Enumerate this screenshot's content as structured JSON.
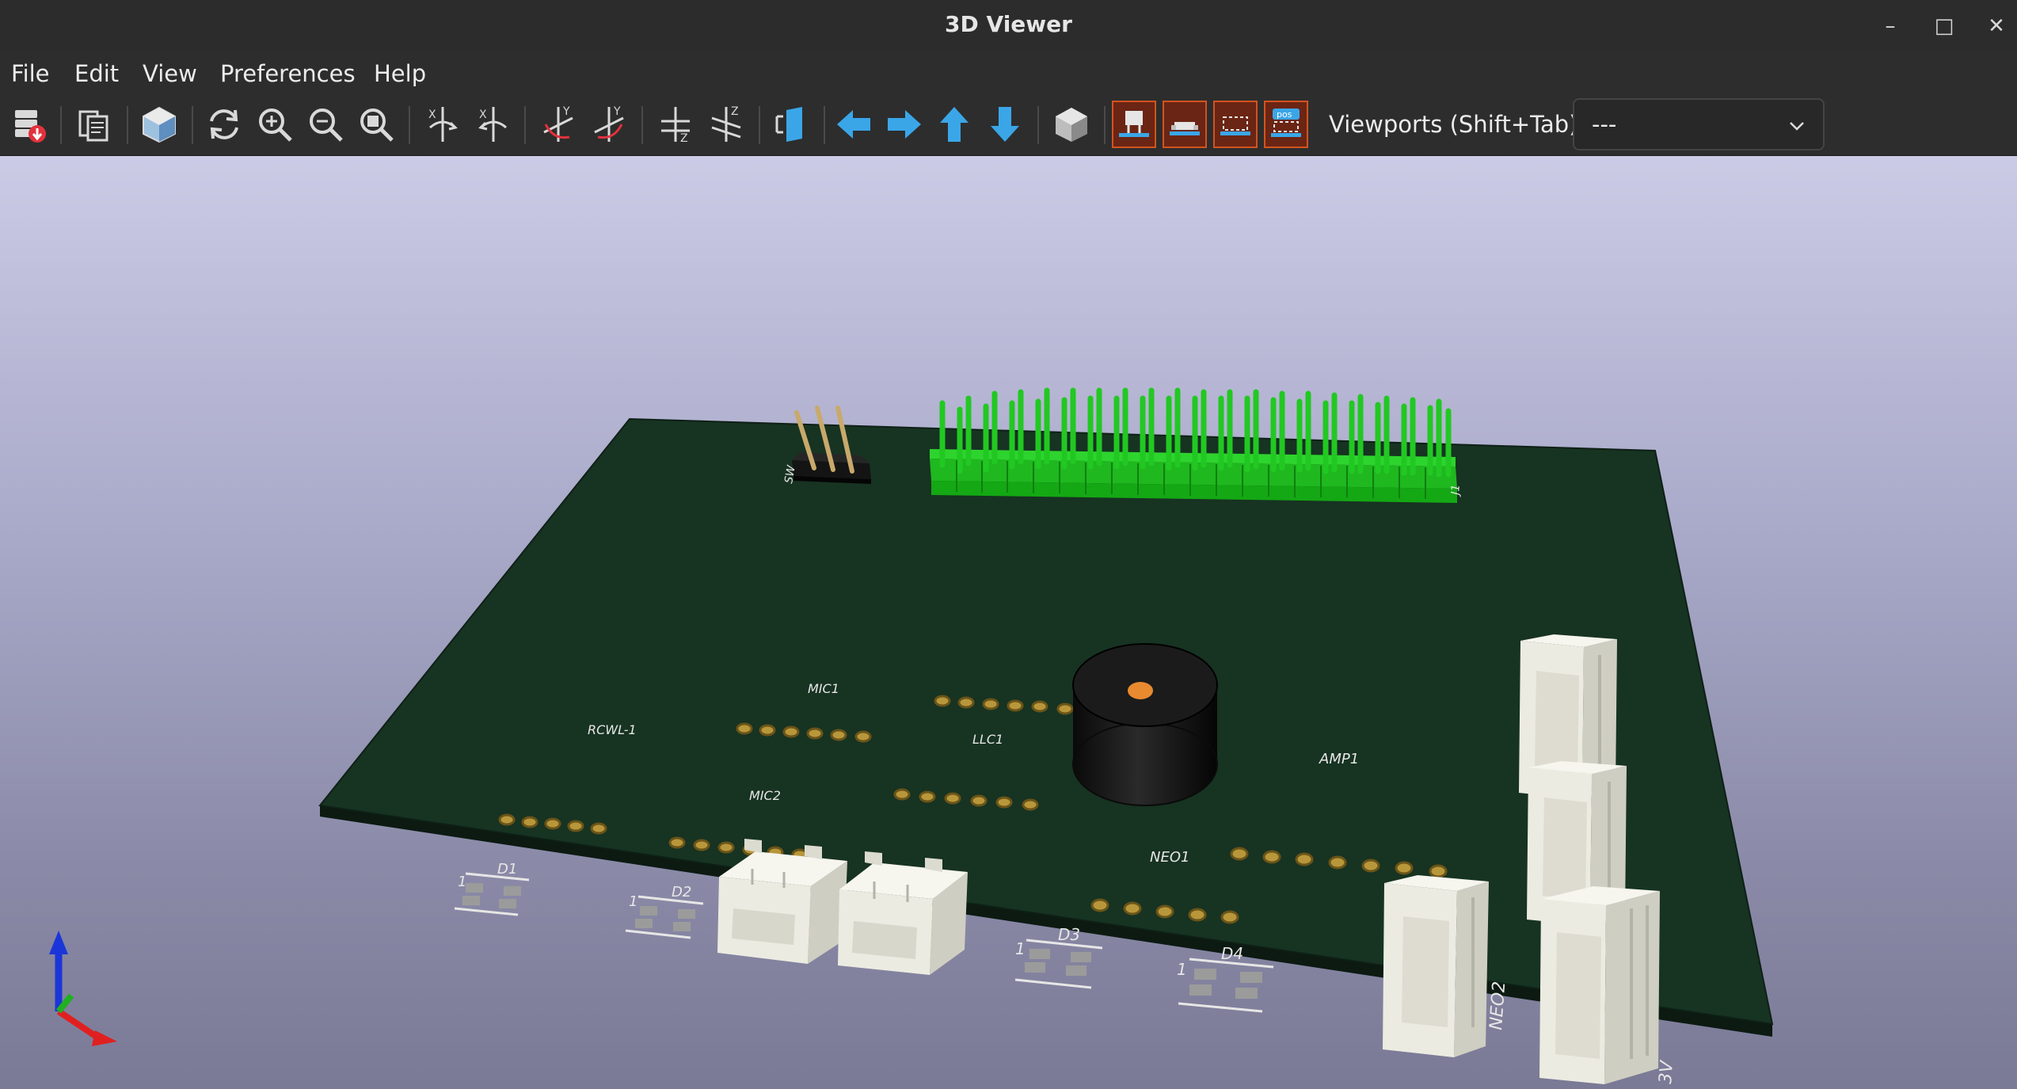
{
  "window": {
    "title": "3D Viewer",
    "controls": {
      "minimize": "–",
      "maximize": "□",
      "close": "✕"
    }
  },
  "menu": {
    "items": [
      {
        "id": "file",
        "label": "File"
      },
      {
        "id": "edit",
        "label": "Edit"
      },
      {
        "id": "view",
        "label": "View"
      },
      {
        "id": "preferences",
        "label": "Preferences"
      },
      {
        "id": "help",
        "label": "Help"
      }
    ]
  },
  "toolbar": {
    "buttons": [
      "export-image-icon",
      "copy-to-clipboard-icon",
      "raytracing-icon",
      "reload-icon",
      "zoom-in-icon",
      "zoom-out-icon",
      "zoom-fit-icon",
      "rotate-x-cw-icon",
      "rotate-x-ccw-icon",
      "rotate-y-cw-icon",
      "rotate-y-ccw-icon",
      "rotate-z-cw-icon",
      "rotate-z-ccw-icon",
      "flip-board-icon",
      "pan-left-icon",
      "pan-right-icon",
      "pan-up-icon",
      "pan-down-icon",
      "ortho-view-icon",
      "show-tht-icon",
      "show-smd-icon",
      "show-virtual-icon",
      "show-not-in-posfile-icon"
    ],
    "toggle_active_color": "#d2541f",
    "toggle_pos_label": "pos",
    "viewports_label": "Viewports (Shift+Tab):",
    "viewports_value": "---"
  },
  "colors": {
    "pcb": "#173322",
    "connector": "#ecebe1",
    "header_green": "#22c822",
    "pad_gold": "#b8973b",
    "buzzer": "#131313",
    "arrow_blue": "#3aa6e8"
  },
  "board": {
    "labels": {
      "mic1": "MIC1",
      "mic2": "MIC2",
      "rcwl": "RCWL-1",
      "llc1": "LLC1",
      "amp1": "AMP1",
      "neo1": "NEO1",
      "d1": "D1",
      "d2": "D2",
      "d3": "D3",
      "d4": "D4",
      "j1": "J1",
      "neo2": "NEO2",
      "v3": "3V",
      "sw": "SW",
      "pin1": "1"
    }
  }
}
